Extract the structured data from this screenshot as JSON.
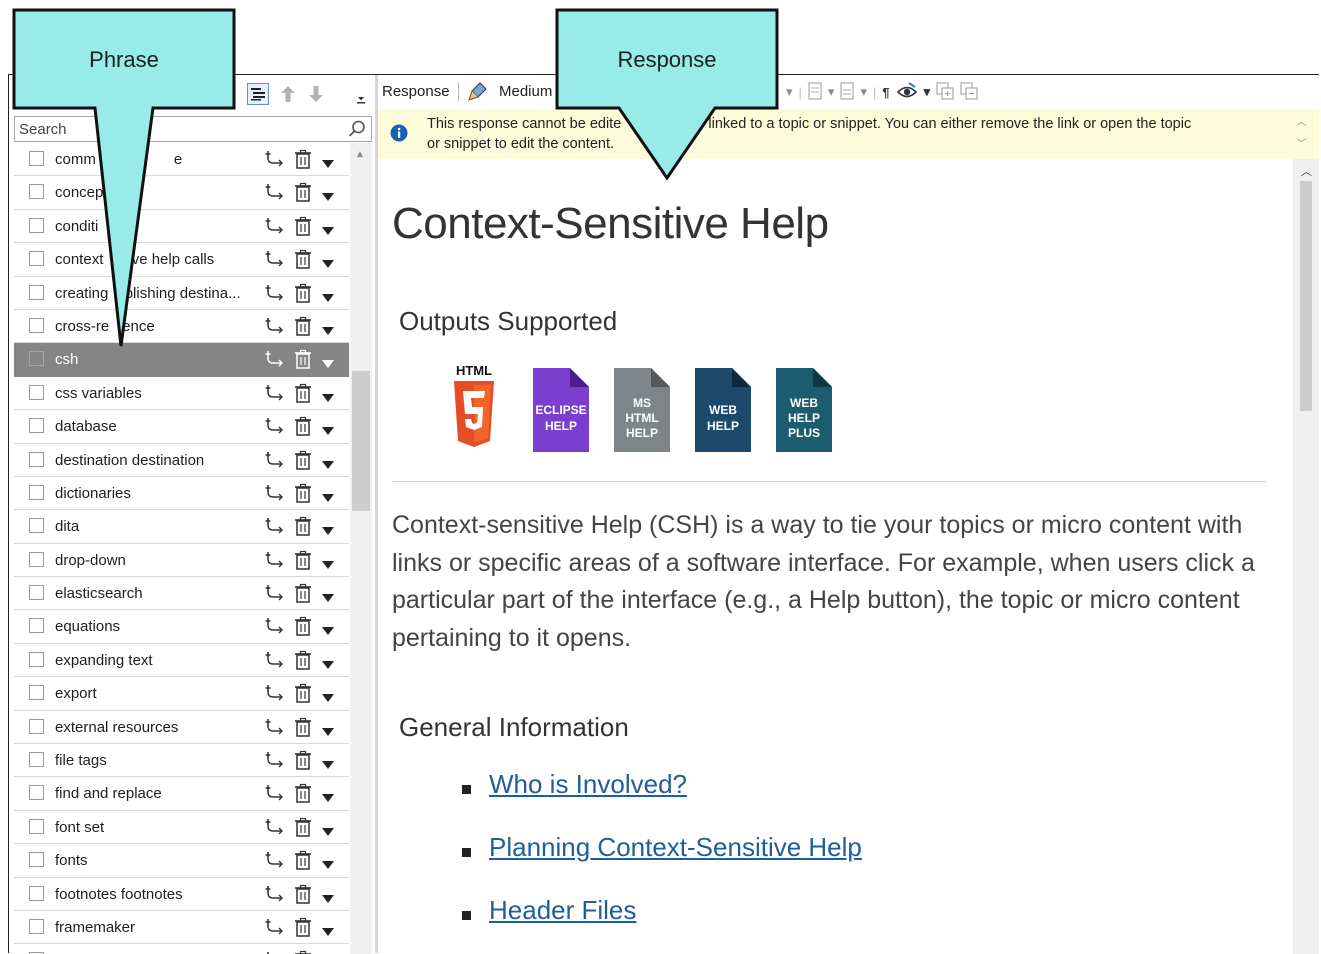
{
  "callouts": {
    "phrase": "Phrase",
    "response": "Response"
  },
  "search": {
    "placeholder": "Search"
  },
  "phrases": [
    {
      "label": "comm",
      "label_after": "e",
      "selected": false
    },
    {
      "label": "concep",
      "label_after": "",
      "selected": false
    },
    {
      "label": "conditi",
      "label_after": "",
      "selected": false
    },
    {
      "label": "context",
      "label_after": "sitive help calls",
      "selected": false
    },
    {
      "label": "creating",
      "label_after": "ublishing destina...",
      "selected": false
    },
    {
      "label": "cross-re",
      "label_after": "rence",
      "selected": false
    },
    {
      "label": "csh",
      "label_after": "",
      "selected": true
    },
    {
      "label": "css variables",
      "label_after": "",
      "selected": false
    },
    {
      "label": "database",
      "label_after": "",
      "selected": false
    },
    {
      "label": "destination destination",
      "label_after": "",
      "selected": false
    },
    {
      "label": "dictionaries",
      "label_after": "",
      "selected": false
    },
    {
      "label": "dita",
      "label_after": "",
      "selected": false
    },
    {
      "label": "drop-down",
      "label_after": "",
      "selected": false
    },
    {
      "label": "elasticsearch",
      "label_after": "",
      "selected": false
    },
    {
      "label": "equations",
      "label_after": "",
      "selected": false
    },
    {
      "label": "expanding text",
      "label_after": "",
      "selected": false
    },
    {
      "label": "export",
      "label_after": "",
      "selected": false
    },
    {
      "label": "external resources",
      "label_after": "",
      "selected": false
    },
    {
      "label": "file tags",
      "label_after": "",
      "selected": false
    },
    {
      "label": "find and replace",
      "label_after": "",
      "selected": false
    },
    {
      "label": "font set",
      "label_after": "",
      "selected": false
    },
    {
      "label": "fonts",
      "label_after": "",
      "selected": false
    },
    {
      "label": "footnotes footnotes",
      "label_after": "",
      "selected": false
    },
    {
      "label": "framemaker",
      "label_after": "",
      "selected": false
    },
    {
      "label": "",
      "label_after": "",
      "selected": false
    }
  ],
  "toolbar": {
    "response_label": "Response",
    "medium_label": "Medium"
  },
  "notice": {
    "text_line1_a": "This response cannot be edite",
    "text_line1_b": "se it is linked to a topic or snippet. You can either remove the link or open the topic",
    "text_line2": "or snippet to edit the content."
  },
  "content": {
    "title": "Context-Sensitive Help",
    "outputs_heading": "Outputs Supported",
    "outputs": [
      {
        "name": "html5-icon",
        "label": "HTML",
        "color": "#e44d26"
      },
      {
        "name": "eclipse-help-icon",
        "label": "ECLIPSE HELP",
        "color": "#7b3fd0"
      },
      {
        "name": "ms-html-help-icon",
        "label": "MS HTML HELP",
        "color": "#7d8588"
      },
      {
        "name": "web-help-icon",
        "label": "WEB HELP",
        "color": "#1d4a6b"
      },
      {
        "name": "web-help-plus-icon",
        "label": "WEB HELP PLUS",
        "color": "#1b5c6e"
      }
    ],
    "intro": "Context-sensitive Help (CSH) is a way to tie your topics or micro content with links or specific areas of a software interface. For example, when users click a particular part of the interface (e.g., a Help button), the topic or micro content pertaining to it opens.",
    "general_heading": "General Information",
    "links": [
      "Who is Involved?",
      "Planning Context-Sensitive Help",
      "Header Files"
    ]
  },
  "colors": {
    "callout_fill": "#97ebe8",
    "selected_row": "#858585",
    "notice_bg": "#fdfbd9",
    "link": "#1f5e9c"
  }
}
